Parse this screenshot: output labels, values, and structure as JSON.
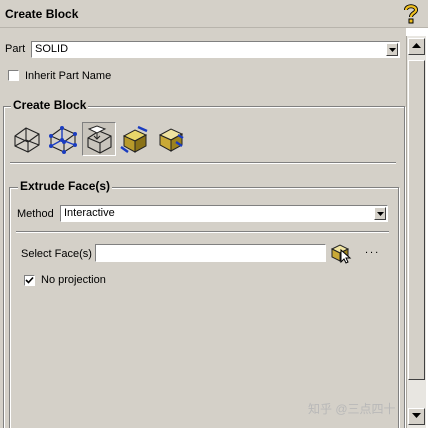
{
  "window": {
    "title": "Create Block",
    "help_icon": "help-question-icon"
  },
  "part": {
    "label": "Part",
    "value": "SOLID"
  },
  "inherit_part_name": {
    "label": "Inherit Part Name",
    "checked": false
  },
  "create_block": {
    "title": "Create Block",
    "tools": [
      {
        "icon": "wireframe-cube-icon",
        "selected": false
      },
      {
        "icon": "vertex-cube-icon",
        "selected": false
      },
      {
        "icon": "extrude-face-cube-icon",
        "selected": true
      },
      {
        "icon": "solid-cube-arrows-icon",
        "selected": false
      },
      {
        "icon": "solid-cube-faces-icon",
        "selected": false
      }
    ]
  },
  "extrude_faces": {
    "title": "Extrude Face(s)",
    "method_label": "Method",
    "method_value": "Interactive",
    "select_label": "Select Face(s)",
    "select_value": "",
    "more_label": "...",
    "no_projection_label": "No projection",
    "no_projection_checked": true
  },
  "watermark": "知乎 @三点四十"
}
